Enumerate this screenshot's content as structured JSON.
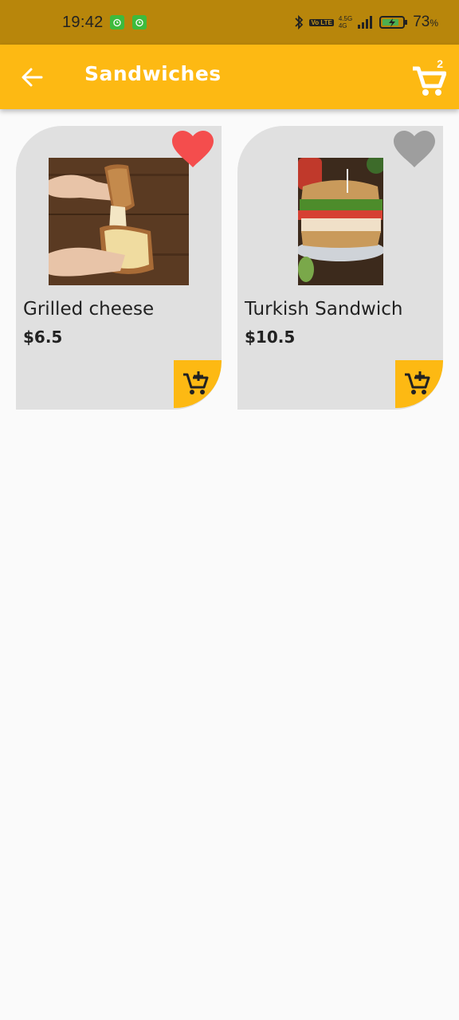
{
  "status_bar": {
    "time": "19:42",
    "net_top": "4.5G",
    "net_bottom": "4G",
    "volte": "Vo LTE",
    "battery": "73",
    "battery_unit": "%"
  },
  "app_bar": {
    "title": "Sandwiches",
    "cart_count": "2"
  },
  "colors": {
    "accent": "#fdb913",
    "status_bar": "#b8860b",
    "card_bg": "#e0e0e0",
    "favorite_on": "#f44d4d",
    "favorite_off": "#9e9e9e"
  },
  "products": [
    {
      "name": "Grilled cheese",
      "price": "$6.5",
      "favorite": true
    },
    {
      "name": "Turkish Sandwich",
      "price": "$10.5",
      "favorite": false
    }
  ]
}
